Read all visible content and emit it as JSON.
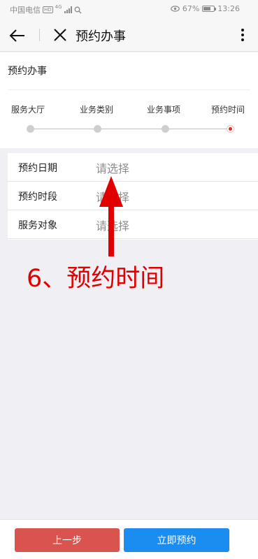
{
  "status": {
    "carrier": "中国电信",
    "hd": "HD",
    "network": "4G",
    "battery": "67%",
    "battery_level": 0.67,
    "time": "13:26"
  },
  "nav": {
    "title": "预约办事"
  },
  "card": {
    "title": "预约办事"
  },
  "steps": [
    {
      "label": "服务大厅",
      "active": false
    },
    {
      "label": "业务类别",
      "active": false
    },
    {
      "label": "业务事项",
      "active": false
    },
    {
      "label": "预约时间",
      "active": true
    }
  ],
  "form": {
    "rows": [
      {
        "label": "预约日期",
        "placeholder": "请选择"
      },
      {
        "label": "预约时段",
        "placeholder": "请选择"
      },
      {
        "label": "服务对象",
        "placeholder": "请选择"
      }
    ]
  },
  "annotation": {
    "text": "6、预约时间",
    "color": "#e00000"
  },
  "buttons": {
    "prev": "上一步",
    "submit": "立即预约"
  },
  "colors": {
    "prev_button": "#d9534f",
    "submit_button": "#1b8cf0",
    "active_step": "#e02a2a"
  }
}
